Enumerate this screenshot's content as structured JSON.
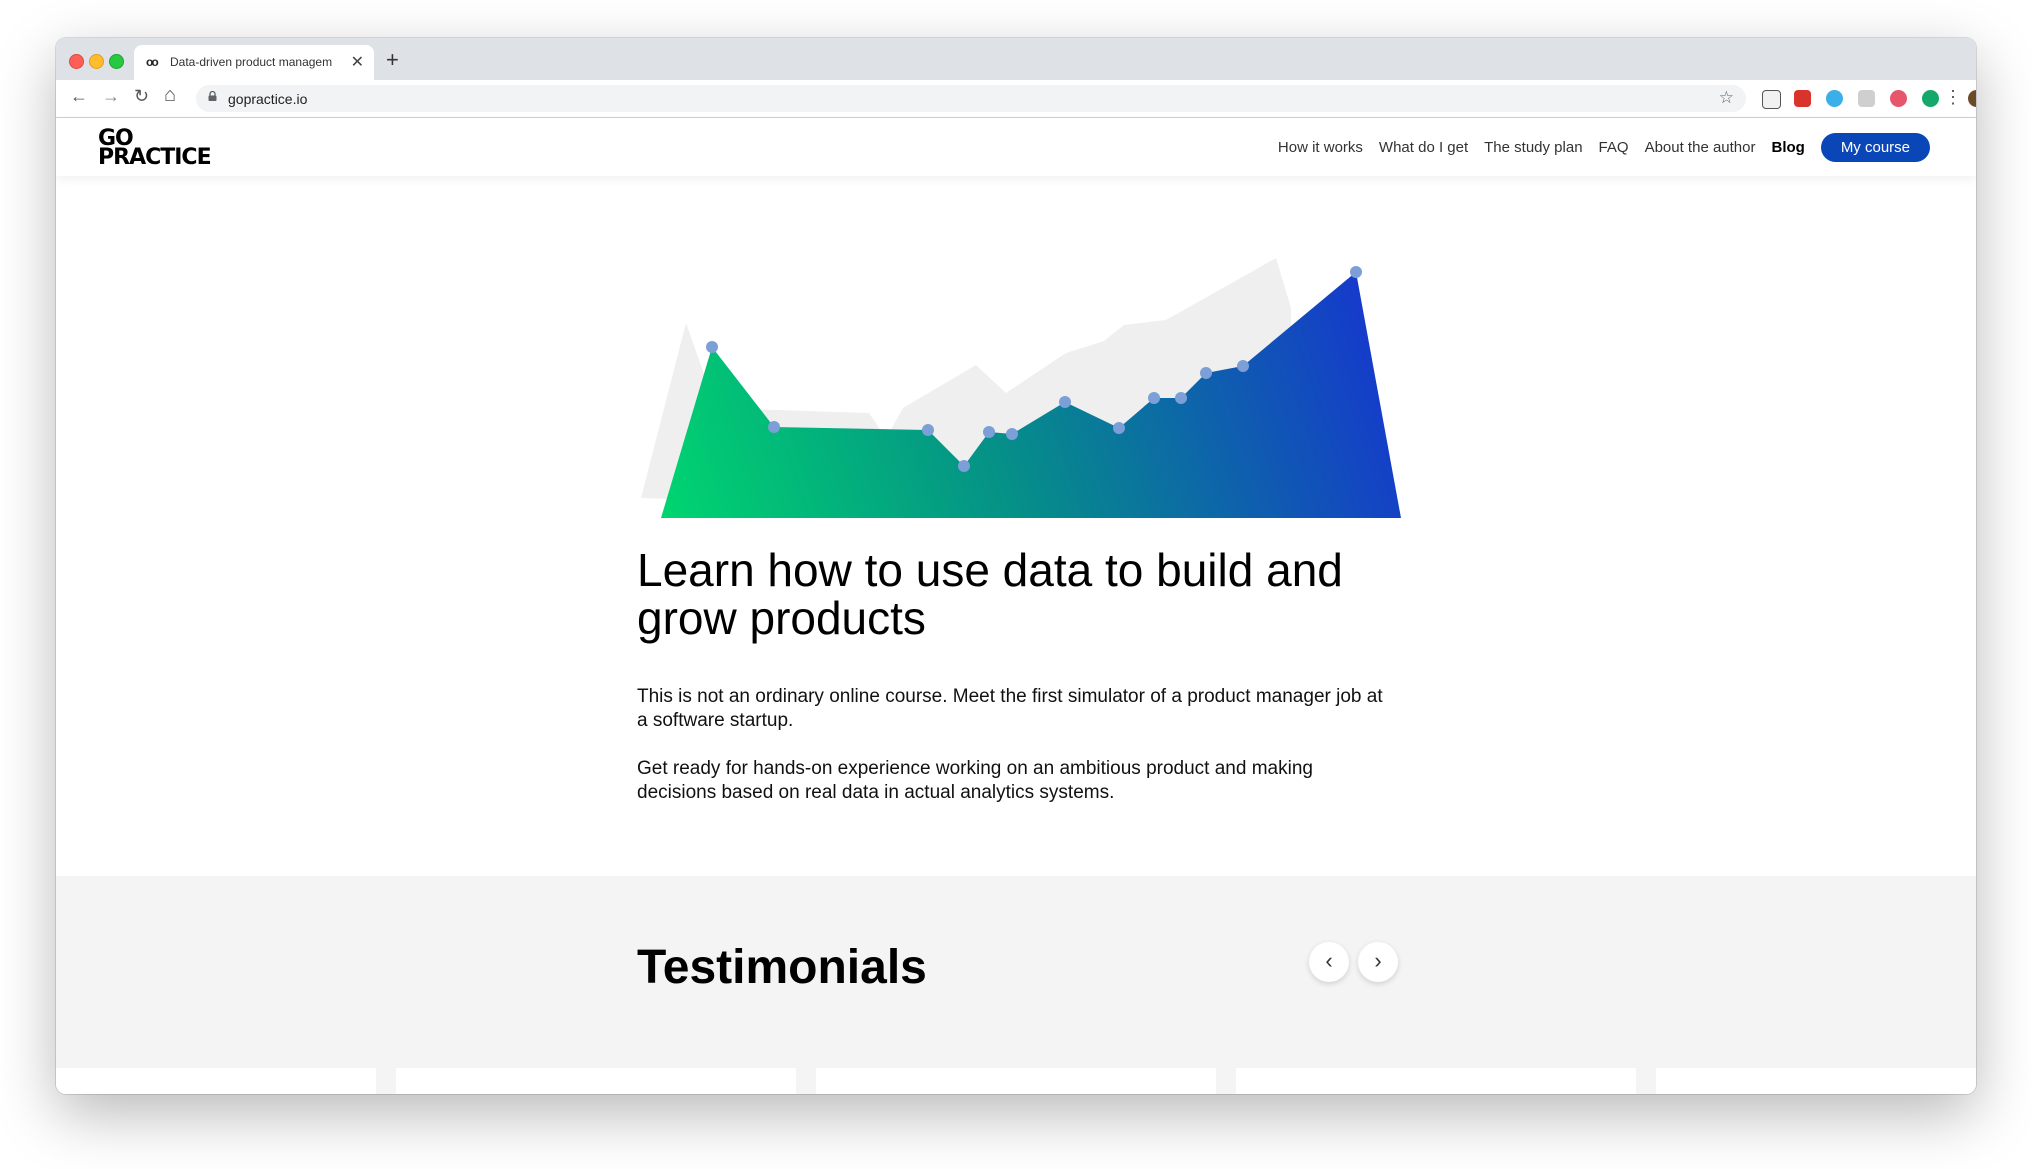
{
  "browser": {
    "tab_title": "Data-driven product managem",
    "tab_favicon": "oo",
    "close_glyph": "✕",
    "new_tab_glyph": "+",
    "url": "gopractice.io",
    "back_glyph": "←",
    "forward_glyph": "→",
    "reload_glyph": "↻",
    "home_glyph": "⌂",
    "star_glyph": "☆",
    "menu_glyph": "⋮",
    "extensions": [
      "pocket-icon",
      "office-icon",
      "grammar-icon",
      "camera-icon",
      "lastpass-icon",
      "grammarly-icon",
      "profile-avatar"
    ]
  },
  "site": {
    "logo_line1": "GO",
    "logo_line2": "PRACTICE",
    "nav": [
      "How it works",
      "What do I get",
      "The study plan",
      "FAQ",
      "About the author"
    ],
    "blog": "Blog",
    "cta": "My course"
  },
  "hero": {
    "title": "Learn how to use data to build and grow products",
    "p1": "This is not an ordinary online course. Meet the first simulator of a product manager job at a software startup.",
    "p2": "Get ready for hands-on experience working on an ambitious product and making decisions based on real data in actual analytics systems."
  },
  "testimonials": {
    "title": "Testimonials",
    "prev": "‹",
    "next": "›"
  },
  "colors": {
    "cta": "#0a46b8",
    "chart_start": "#00d66f",
    "chart_mid": "#059187",
    "chart_end": "#1638cd",
    "chart_point": "#7b9fd6"
  }
}
